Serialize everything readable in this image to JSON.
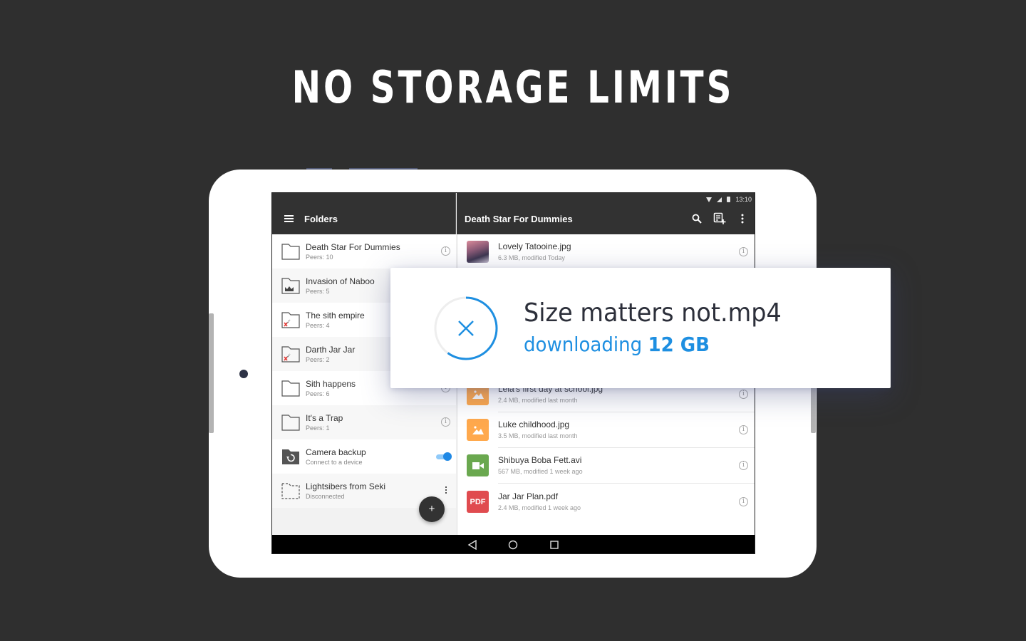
{
  "headline": "NO STORAGE LIMITS",
  "colors": {
    "background": "#2f2f2f",
    "toolbar": "#323232",
    "accent_blue": "#1e8fe1",
    "toggle_on": "#1e88e5",
    "image_orange": "#ffa94d",
    "video_green": "#6aa84f",
    "pdf_red": "#e04b4f"
  },
  "status_bar": {
    "time": "13:10",
    "icons": [
      "wifi-icon",
      "signal-icon",
      "battery-icon"
    ]
  },
  "left_panel": {
    "title": "Folders",
    "menu_icon": "hamburger-icon",
    "folders": [
      {
        "name": "Death Star For Dummies",
        "sub": "Peers: 10",
        "icon": "folder-icon",
        "action": "info"
      },
      {
        "name": "Invasion of Naboo",
        "sub": "Peers: 5",
        "icon": "folder-crown-icon",
        "action": "info"
      },
      {
        "name": "The sith empire",
        "sub": "Peers: 4",
        "icon": "folder-error-icon",
        "action": "info"
      },
      {
        "name": "Darth Jar Jar",
        "sub": "Peers: 2",
        "icon": "folder-error-icon",
        "action": "info"
      },
      {
        "name": "Sith happens",
        "sub": "Peers: 6",
        "icon": "folder-icon",
        "action": "info"
      },
      {
        "name": "It's a Trap",
        "sub": "Peers: 1",
        "icon": "folder-icon",
        "action": "info"
      },
      {
        "name": "Camera backup",
        "sub": "Connect to a device",
        "icon": "camera-backup-folder-icon",
        "action": "toggle",
        "toggle_on": true
      },
      {
        "name": "Lightsibers from Seki",
        "sub": "Disconnected",
        "icon": "folder-disconnected-icon",
        "action": "more"
      }
    ],
    "fab_label": "+"
  },
  "right_panel": {
    "title": "Death Star For Dummies",
    "toolbar_icons": [
      "search-icon",
      "add-note-icon",
      "more-vert-icon"
    ],
    "files": [
      {
        "name": "Lovely Tatooine.jpg",
        "sub": "6.3 MB, modified Today",
        "type": "photo"
      },
      {
        "name": "Leia's first day at school.jpg",
        "sub": "2.4 MB, modified last month",
        "type": "image"
      },
      {
        "name": "Luke childhood.jpg",
        "sub": "3.5 MB, modified last month",
        "type": "image"
      },
      {
        "name": "Shibuya Boba Fett.avi",
        "sub": "567 MB, modified 1 week ago",
        "type": "video"
      },
      {
        "name": "Jar Jar Plan.pdf",
        "sub": "2.4 MB, modified 1 week ago",
        "type": "pdf",
        "badge": "PDF"
      }
    ]
  },
  "download_popup": {
    "file_name": "Size matters not.mp4",
    "status_prefix": "downloading",
    "size": "12 GB",
    "progress": 0.6
  },
  "nav_bar": [
    "back-icon",
    "home-icon",
    "recents-icon"
  ]
}
